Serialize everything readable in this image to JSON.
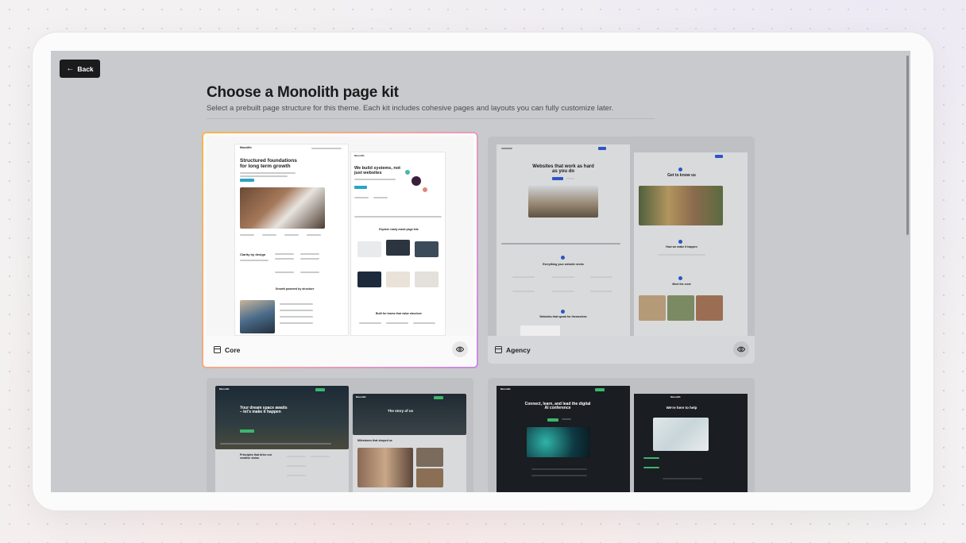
{
  "header": {
    "back_label": "Back",
    "title": "Choose a Monolith page kit",
    "subtitle": "Select a prebuilt page structure for this theme. Each kit includes cohesive pages and layouts you can fully customize later."
  },
  "kits": [
    {
      "name": "Core",
      "selected": true,
      "preview": {
        "brand": "Monolith",
        "headline_left": "Structured foundations for long term growth",
        "headline_right": "We build systems, not just websites",
        "section_1": "Clarity by design",
        "section_2": "Growth powered by structure",
        "section_3": "Explore ready made page kits",
        "section_4": "Built for teams that value structure"
      }
    },
    {
      "name": "Agency",
      "selected": false,
      "preview": {
        "headline_left": "Websites that work as hard as you do",
        "headline_right": "Get to know us",
        "section_1": "Everything your website needs",
        "section_2": "Websites that speak for themselves",
        "section_3": "How we make it happen",
        "section_4": "Meet the crew"
      }
    },
    {
      "name": "",
      "selected": false,
      "preview": {
        "brand": "Monolith",
        "headline_left": "Your dream space awaits – let's make it happen",
        "headline_right": "The story of us",
        "section_1": "Principles that drive our creative vision",
        "section_2": "Milestones that shaped us"
      }
    },
    {
      "name": "",
      "selected": false,
      "preview": {
        "brand": "Monolith",
        "headline_left": "Connect, learn, and lead the digital AI conference",
        "headline_right": "We're here to help"
      }
    }
  ],
  "icons": {
    "back": "arrow-left-icon",
    "kit": "layout-icon",
    "preview": "eye-icon"
  },
  "colors": {
    "accent_blue": "#2a56c6",
    "accent_green": "#3db66a",
    "selection_gradient": [
      "#f5b84a",
      "#f2a3a3",
      "#c88ae8"
    ]
  }
}
